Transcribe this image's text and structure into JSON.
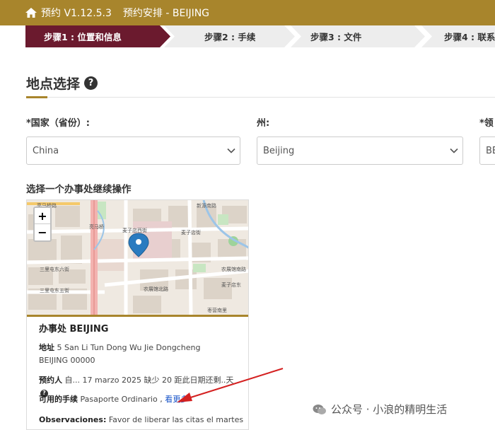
{
  "header": {
    "app_name": "预约 V1.12.5.3",
    "subtitle": "预约安排 - BEIJING"
  },
  "steps": [
    {
      "label": "步骤1 : 位置和信息",
      "active": true
    },
    {
      "label": "步骤2 : 手续",
      "active": false
    },
    {
      "label": "步骤3 : 文件",
      "active": false
    },
    {
      "label": "步骤4 : 联系",
      "active": false
    }
  ],
  "section": {
    "title": "地点选择",
    "help_glyph": "?"
  },
  "fields": {
    "country_label": "*国家（省份）:",
    "country_value": "China",
    "state_label": "州:",
    "state_value": "Beijing",
    "consulate_label": "*领",
    "consulate_value": "BE"
  },
  "office_heading": "选择一个办事处继续操作",
  "map": {
    "zoom_in": "+",
    "zoom_out": "−",
    "street_labels": [
      "亮马桥",
      "麦子店西街",
      "麦子店街",
      "三里屯东六街",
      "三里屯东五街",
      "农展馆北路",
      "农展馆南路",
      "亮马桥路",
      "麦子店东",
      "枣营南里",
      "新源南路"
    ]
  },
  "office": {
    "name": "办事处 BEIJING",
    "address_label": "地址",
    "address_value": "5 San Li Tun Dong Wu Jie Dongcheng",
    "address_line2": "BEIJING 00000",
    "appointment_label": "预约人",
    "appointment_value": "自... 17 marzo 2025 缺少 20 距此日期还剩..天",
    "procedures_label": "可用的手续",
    "procedures_value": "Pasaporte Ordinario ,",
    "see_more": "看更多",
    "observations_label": "Observaciones:",
    "observations_value": "Favor de liberar las citas el martes"
  },
  "watermark": "公众号 · 小浪的精明生活",
  "colors": {
    "brand_gold": "#a8852c",
    "step_active": "#6b1a2e",
    "step_inactive": "#ededed",
    "link": "#1a56c9",
    "annotation_arrow": "#d42020"
  }
}
